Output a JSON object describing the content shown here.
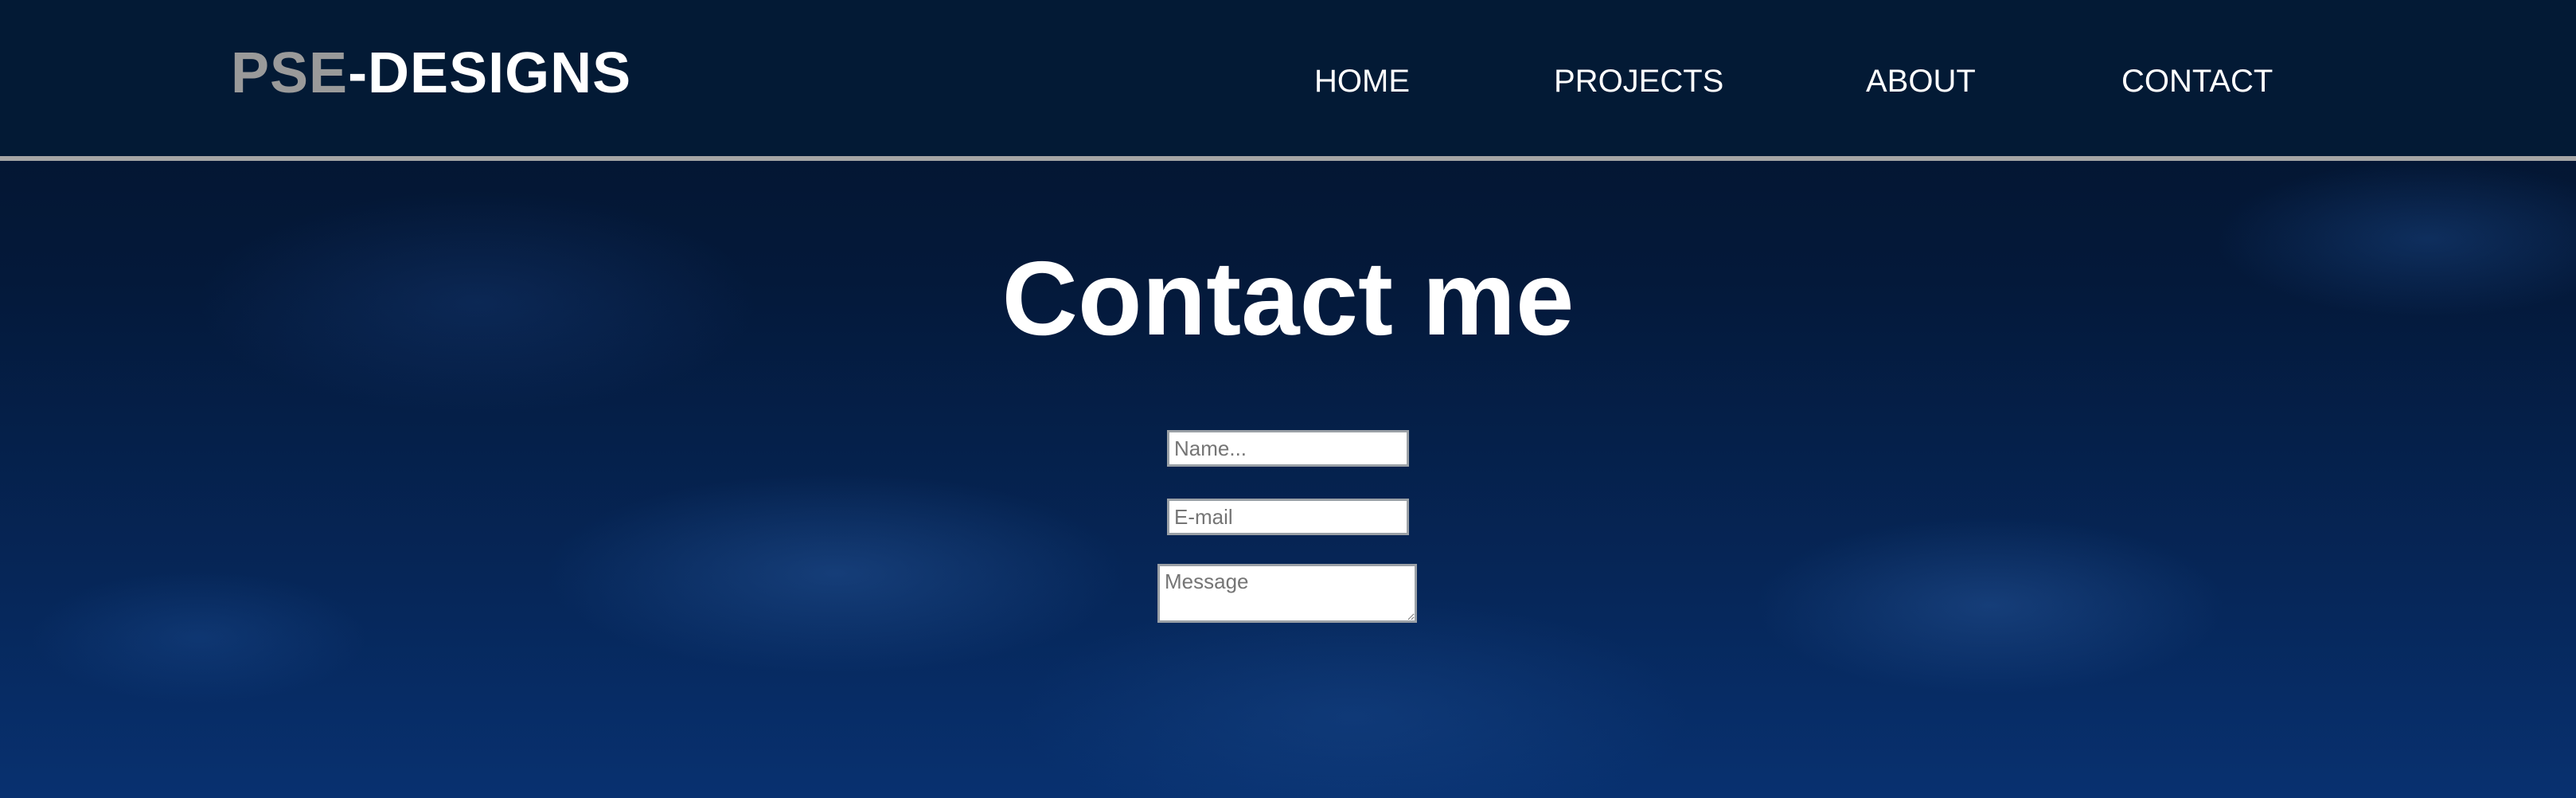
{
  "header": {
    "logo_part1": "PSE",
    "logo_part2": "-DESIGNS",
    "nav": {
      "home": "HOME",
      "projects": "PROJECTS",
      "about": "ABOUT",
      "contact": "CONTACT"
    }
  },
  "main": {
    "title": "Contact me",
    "form": {
      "name_placeholder": "Name...",
      "email_placeholder": "E-mail",
      "message_placeholder": "Message"
    }
  },
  "colors": {
    "header_bg": "#031a35",
    "logo_accent": "#9a9a9a",
    "header_border": "#a6a6a6",
    "text": "#ffffff"
  }
}
